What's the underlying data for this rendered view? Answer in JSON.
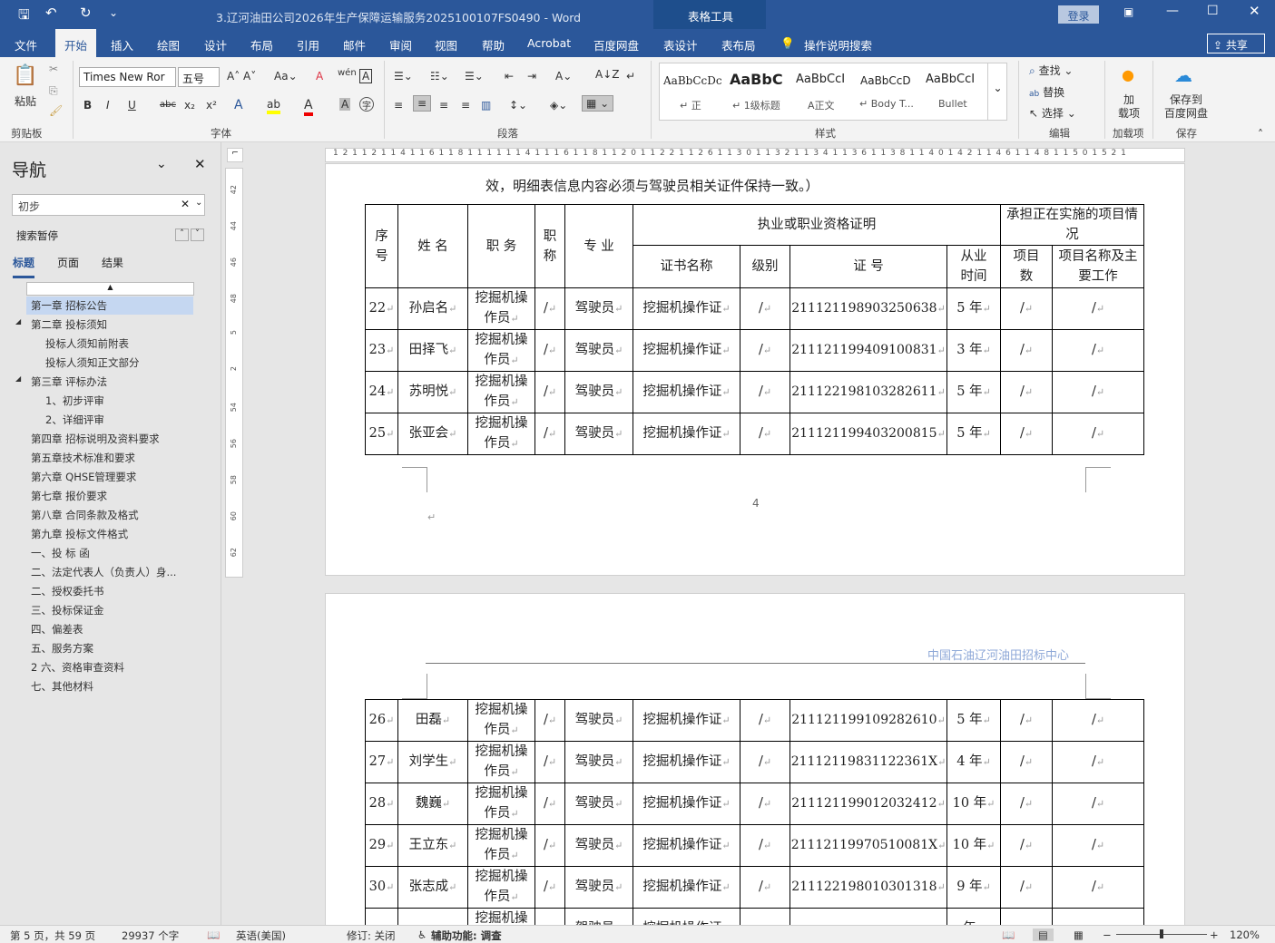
{
  "window": {
    "title": "3.辽河油田公司2026年生产保障运输服务2025100107FS0490 - Word",
    "table_tools": "表格工具",
    "login": "登录",
    "share": "共享"
  },
  "tabs": [
    "文件",
    "开始",
    "插入",
    "绘图",
    "设计",
    "布局",
    "引用",
    "邮件",
    "审阅",
    "视图",
    "帮助",
    "Acrobat",
    "百度网盘",
    "表设计",
    "表布局"
  ],
  "tell_me": "操作说明搜索",
  "ribbon": {
    "paste": "粘贴",
    "font_name": "Times New Ror",
    "font_size": "五号",
    "groups": [
      "剪贴板",
      "字体",
      "段落",
      "样式",
      "编辑",
      "加载项",
      "保存"
    ],
    "styles": [
      {
        "preview": "AaBbCcDc",
        "name": "↵ 正"
      },
      {
        "preview": "AaBbC",
        "name": "↵ 1级标题"
      },
      {
        "preview": "AaBbCcI",
        "name": "A正文"
      },
      {
        "preview": "AaBbCcD",
        "name": "↵ Body T..."
      },
      {
        "preview": "AaBbCcI",
        "name": "Bullet"
      }
    ],
    "find": "查找",
    "replace": "替换",
    "select": "选择",
    "addins": "加\n载项",
    "save_baidu": "保存到\n百度网盘"
  },
  "nav": {
    "title": "导航",
    "search_value": "初步",
    "search_status": "搜索暂停",
    "tabs": [
      "标题",
      "页面",
      "结果"
    ],
    "items": [
      {
        "t": "第一章  招标公告",
        "l": 0,
        "sel": true
      },
      {
        "t": "第二章  投标须知",
        "l": 0,
        "exp": true
      },
      {
        "t": "投标人须知前附表",
        "l": 1
      },
      {
        "t": "投标人须知正文部分",
        "l": 1
      },
      {
        "t": "第三章  评标办法",
        "l": 0,
        "exp": true
      },
      {
        "t": "1、初步评审",
        "l": 1
      },
      {
        "t": "2、详细评审",
        "l": 1
      },
      {
        "t": "第四章  招标说明及资料要求",
        "l": 0
      },
      {
        "t": "第五章技术标准和要求",
        "l": 0
      },
      {
        "t": "第六章  QHSE管理要求",
        "l": 0
      },
      {
        "t": "第七章  报价要求",
        "l": 0
      },
      {
        "t": "第八章  合同条款及格式",
        "l": 0
      },
      {
        "t": "第九章  投标文件格式",
        "l": 0
      },
      {
        "t": "一、投 标 函",
        "l": 0
      },
      {
        "t": "二、法定代表人（负责人）身...",
        "l": 0
      },
      {
        "t": "二、授权委托书",
        "l": 0
      },
      {
        "t": "三、投标保证金",
        "l": 0
      },
      {
        "t": "四、偏差表",
        "l": 0
      },
      {
        "t": "五、服务方案",
        "l": 0
      },
      {
        "t": "2 六、资格审查资料",
        "l": 0
      },
      {
        "t": "七、其他材料",
        "l": 0
      }
    ]
  },
  "ruler": {
    "h": "1 2 1   1   2 1   1 4 1   1 6 1   1 8 1   1 1 1   1 1 4 1   1 1 6   1 1 8 1   1 2 0 1   1 2 2 1   1 2 6 1   1 3 0 1   1 3 2 1   1 3 4 1   1 3 6 1   1 3 8 1   1 4 0 1   4 2 1   1 4 6 1   1 4 8 1   1 5 0   1 5 2 1",
    "v": [
      "42",
      "44",
      "46",
      "48",
      "5",
      "2",
      "54",
      "56",
      "58",
      "60",
      "62"
    ]
  },
  "doc": {
    "intro": "效，明细表信息内容必须与驾驶员相关证件保持一致。）",
    "page_number": "4",
    "header_text": "中国石油辽河油田招标中心",
    "headers": {
      "seq": "序号",
      "name": "姓 名",
      "duty": "职 务",
      "title": "职称",
      "major": "专 业",
      "cert_group": "执业或职业资格证明",
      "project_group": "承担正在实施的项目情况",
      "cert_name": "证书名称",
      "level": "级别",
      "cert_no": "证 号",
      "years": "从业时间",
      "proj_count": "项目数",
      "proj_name": "项目名称及主要工作"
    },
    "rows_page1": [
      [
        "22",
        "孙启名",
        "挖掘机操作员",
        "/",
        "驾驶员",
        "挖掘机操作证",
        "/",
        "211121198903250638",
        "5 年",
        "/",
        "/"
      ],
      [
        "23",
        "田择飞",
        "挖掘机操作员",
        "/",
        "驾驶员",
        "挖掘机操作证",
        "/",
        "211121199409100831",
        "3 年",
        "/",
        "/"
      ],
      [
        "24",
        "苏明悦",
        "挖掘机操作员",
        "/",
        "驾驶员",
        "挖掘机操作证",
        "/",
        "211122198103282611",
        "5 年",
        "/",
        "/"
      ],
      [
        "25",
        "张亚会",
        "挖掘机操作员",
        "/",
        "驾驶员",
        "挖掘机操作证",
        "/",
        "211121199403200815",
        "5 年",
        "/",
        "/"
      ]
    ],
    "rows_page2": [
      [
        "26",
        "田磊",
        "挖掘机操作员",
        "/",
        "驾驶员",
        "挖掘机操作证",
        "/",
        "211121199109282610",
        "5 年",
        "/",
        "/"
      ],
      [
        "27",
        "刘学生",
        "挖掘机操作员",
        "/",
        "驾驶员",
        "挖掘机操作证",
        "/",
        "21112119831122361X",
        "4 年",
        "/",
        "/"
      ],
      [
        "28",
        "魏巍",
        "挖掘机操作员",
        "/",
        "驾驶员",
        "挖掘机操作证",
        "/",
        "211121199012032412",
        "10 年",
        "/",
        "/"
      ],
      [
        "29",
        "王立东",
        "挖掘机操作员",
        "/",
        "驾驶员",
        "挖掘机操作证",
        "/",
        "21112119970510081X",
        "10 年",
        "/",
        "/"
      ],
      [
        "30",
        "张志成",
        "挖掘机操作员",
        "/",
        "驾驶员",
        "挖掘机操作证",
        "/",
        "211122198010301318",
        "9 年",
        "/",
        "/"
      ],
      [
        "",
        "",
        "挖掘机操作员",
        "",
        "驾驶员",
        "挖掘机操作证",
        "",
        "",
        "年",
        "",
        ""
      ]
    ]
  },
  "status": {
    "page": "第 5 页，共 59 页",
    "words": "29937 个字",
    "lang": "英语(美国)",
    "track": "修订: 关闭",
    "access": "辅助功能: 调查",
    "zoom": "120%"
  },
  "colors": {
    "brand": "#2b579a",
    "selected": "#c5d7f1"
  }
}
